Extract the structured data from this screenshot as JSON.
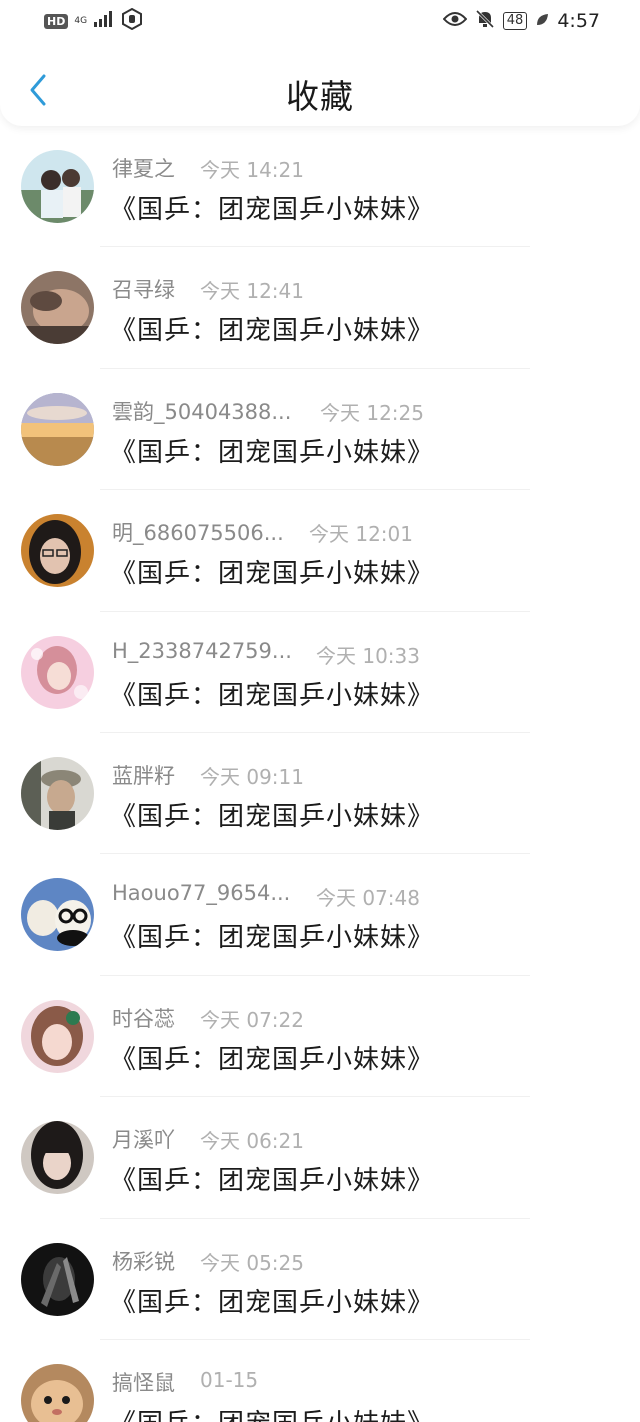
{
  "status_bar": {
    "hd": "HD",
    "network": "4G",
    "battery": "48",
    "time": "4:57"
  },
  "header": {
    "title": "收藏",
    "back_icon": "chevron-left-icon"
  },
  "favorites": [
    {
      "user": "律夏之",
      "time": "今天 14:21",
      "book": "《国乒：团宠国乒小妹妹》"
    },
    {
      "user": "召寻绿",
      "time": "今天 12:41",
      "book": "《国乒：团宠国乒小妹妹》"
    },
    {
      "user": "雲韵_50404388...",
      "time": "今天 12:25",
      "book": "《国乒：团宠国乒小妹妹》"
    },
    {
      "user": "明_686075506...",
      "time": "今天 12:01",
      "book": "《国乒：团宠国乒小妹妹》"
    },
    {
      "user": "H_2338742759...",
      "time": "今天 10:33",
      "book": "《国乒：团宠国乒小妹妹》"
    },
    {
      "user": "蓝胖籽",
      "time": "今天 09:11",
      "book": "《国乒：团宠国乒小妹妹》"
    },
    {
      "user": "Haouo77_9654...",
      "time": "今天 07:48",
      "book": "《国乒：团宠国乒小妹妹》"
    },
    {
      "user": "时谷蕊",
      "time": "今天 07:22",
      "book": "《国乒：团宠国乒小妹妹》"
    },
    {
      "user": "月溪吖",
      "time": "今天 06:21",
      "book": "《国乒：团宠国乒小妹妹》"
    },
    {
      "user": "杨彩锐",
      "time": "今天 05:25",
      "book": "《国乒：团宠国乒小妹妹》"
    },
    {
      "user": "搞怪鼠",
      "time": "01-15",
      "book": "《国乒：团宠国乒小妹妹》"
    }
  ],
  "colors": {
    "accent": "#2f9bd9",
    "title_text": "#1a1a1a",
    "username_text": "#8a8a8a",
    "time_text": "#b0b0b0",
    "book_text": "#1c1c1c"
  }
}
